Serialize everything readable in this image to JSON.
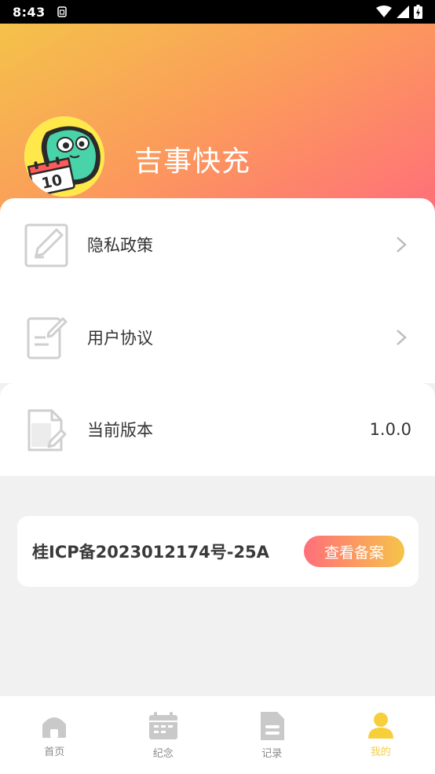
{
  "status_bar": {
    "time": "8:43",
    "icons": [
      "sim-card-icon",
      "wifi-icon",
      "signal-icon",
      "battery-icon"
    ]
  },
  "profile": {
    "app_name": "吉事快充",
    "avatar_icon": "calendar-mascot-avatar",
    "avatar_calendar_number": "10"
  },
  "menu": {
    "items": [
      {
        "label": "隐私政策",
        "icon": "edit-icon"
      },
      {
        "label": "用户协议",
        "icon": "document-edit-icon"
      }
    ]
  },
  "version": {
    "label": "当前版本",
    "value": "1.0.0",
    "icon": "file-edit-icon"
  },
  "icp": {
    "text": "桂ICP备2023012174号-25A",
    "button_label": "查看备案"
  },
  "tabs": [
    {
      "label": "首页",
      "icon": "home-icon",
      "active": false
    },
    {
      "label": "纪念",
      "icon": "calendar-icon",
      "active": false
    },
    {
      "label": "记录",
      "icon": "record-icon",
      "active": false
    },
    {
      "label": "我的",
      "icon": "user-icon",
      "active": true
    }
  ],
  "colors": {
    "accent": "#f6cf3a",
    "gradient_start": "#f4c24a",
    "gradient_end": "#ff6f7a",
    "inactive_icon": "#c9c9c9",
    "text": "#333333"
  }
}
